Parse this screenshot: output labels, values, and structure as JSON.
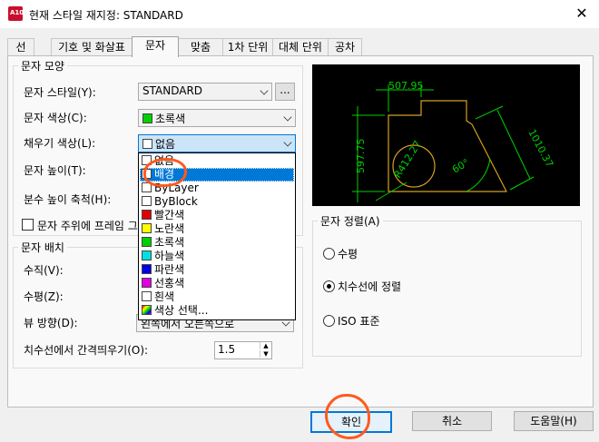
{
  "window": {
    "title": "현재 스타일 재지정: STANDARD",
    "close_glyph": "✕",
    "app_icon_text": "A10"
  },
  "tabs": [
    "선",
    "기호 및 화살표",
    "문자",
    "맞춤",
    "1차 단위",
    "대체 단위",
    "공차"
  ],
  "active_tab": "문자",
  "text_appearance": {
    "title": "문자 모양",
    "style_label": "문자 스타일(Y):",
    "style_value": "STANDARD",
    "style_button": "...",
    "color_label": "문자 색상(C):",
    "color_value": "초록색",
    "fill_label": "채우기 색상(L):",
    "fill_value": "없음",
    "height_label": "문자 높이(T):",
    "fraction_label": "분수 높이 축척(H):",
    "frame_label": "문자 주위에 프레임 그"
  },
  "fill_dropdown": {
    "items": [
      {
        "label": "없음",
        "color": "#ffffff"
      },
      {
        "label": "배경",
        "color": "#ffffff"
      },
      {
        "label": "ByLayer",
        "color": "#ffffff"
      },
      {
        "label": "ByBlock",
        "color": "#ffffff"
      },
      {
        "label": "빨간색",
        "color": "#e00000"
      },
      {
        "label": "노란색",
        "color": "#ffff00"
      },
      {
        "label": "초록색",
        "color": "#00d000"
      },
      {
        "label": "하늘색",
        "color": "#00e0e0"
      },
      {
        "label": "파란색",
        "color": "#0000e0"
      },
      {
        "label": "선홍색",
        "color": "#e000e0"
      },
      {
        "label": "흰색",
        "color": "#ffffff"
      },
      {
        "label": "색상 선택...",
        "color": "multicolor"
      }
    ],
    "selected": "배경"
  },
  "text_placement": {
    "title": "문자 배치",
    "vertical_label": "수직(V):",
    "horizontal_label": "수평(Z):",
    "view_dir_label": "뷰 방향(D):",
    "view_dir_value": "왼쪽에서 오른쪽으로",
    "offset_label": "치수선에서 간격띄우기(O):",
    "offset_value": "1.5"
  },
  "preview": {
    "dim_top": "507.95",
    "dim_left": "597.75",
    "dim_right": "1010.37",
    "dim_radius": "R412.27",
    "dim_angle": "60°"
  },
  "text_alignment": {
    "title": "문자 정렬(A)",
    "options": [
      "수평",
      "치수선에 정렬",
      "ISO 표준"
    ],
    "selected": "치수선에 정렬"
  },
  "buttons": {
    "ok": "확인",
    "cancel": "취소",
    "help": "도움말(H)"
  },
  "colors": {
    "accent": "#0078d7",
    "annotation": "#ff5a1f",
    "preview_bg": "#000000",
    "dim_green": "#00d000",
    "geometry": "#d4a020",
    "leader": "#00c8ff"
  }
}
